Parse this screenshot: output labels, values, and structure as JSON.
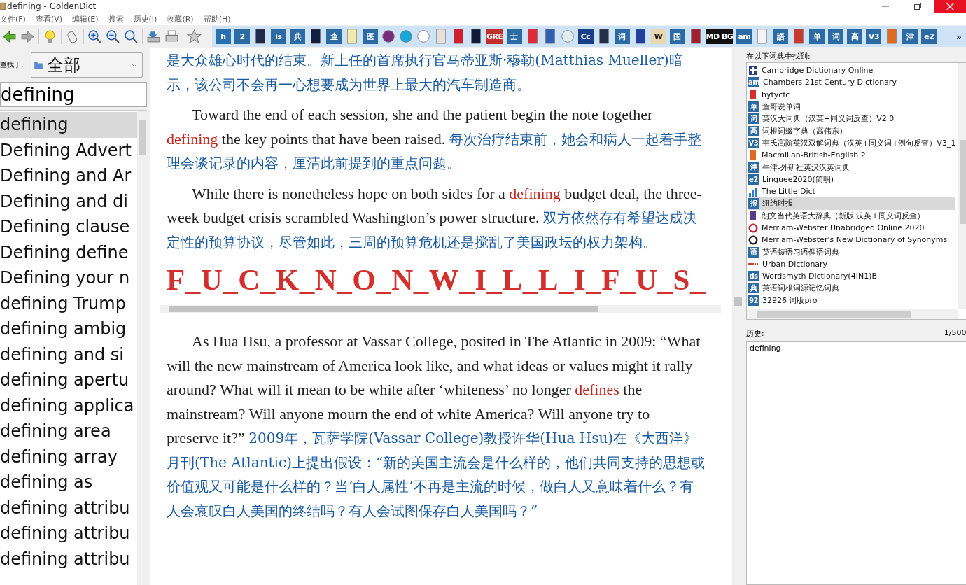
{
  "window": {
    "title": "defining - GoldenDict"
  },
  "menu": [
    "文件(F)",
    "查看(V)",
    "编辑(E)",
    "搜索",
    "历史(I)",
    "收藏(R)",
    "帮助(H)"
  ],
  "toolbar": [
    {
      "kind": "back"
    },
    {
      "kind": "forward"
    },
    {
      "kind": "sep"
    },
    {
      "kind": "bulb"
    },
    {
      "kind": "sep"
    },
    {
      "kind": "mouse"
    },
    {
      "kind": "sep"
    },
    {
      "kind": "zoomin"
    },
    {
      "kind": "zoomout"
    },
    {
      "kind": "zoomreset"
    },
    {
      "kind": "sep"
    },
    {
      "kind": "save"
    },
    {
      "kind": "print"
    },
    {
      "kind": "sep"
    },
    {
      "kind": "star"
    }
  ],
  "dict_bar": [
    {
      "kind": "tile",
      "label": "h",
      "color": "#2a6fb0"
    },
    {
      "kind": "tile",
      "label": "2",
      "color": "#2b6aa3"
    },
    {
      "kind": "book",
      "color": "#1d2a4a"
    },
    {
      "kind": "tile",
      "label": "is",
      "color": "#2b6aa3"
    },
    {
      "kind": "tile",
      "label": "典",
      "color": "#2b6aa3"
    },
    {
      "kind": "book",
      "color": "#142040"
    },
    {
      "kind": "tile",
      "label": "查",
      "color": "#2b6aa3"
    },
    {
      "kind": "book",
      "color": "#f3e9a8"
    },
    {
      "kind": "tile",
      "label": "医",
      "color": "#2b6aa3"
    },
    {
      "kind": "disc",
      "color": "#7a2d7a"
    },
    {
      "kind": "disc",
      "color": "#19a6d8"
    },
    {
      "kind": "disc",
      "color": "#ffffff"
    },
    {
      "kind": "book",
      "color": "#e8e0d8"
    },
    {
      "kind": "book",
      "color": "#d02030"
    },
    {
      "kind": "book",
      "color": "#101a38"
    },
    {
      "kind": "tile",
      "label": "GRE",
      "color": "#c0302a"
    },
    {
      "kind": "tile",
      "label": "士",
      "color": "#2b6aa3"
    },
    {
      "kind": "book",
      "color": "#e02a3a"
    },
    {
      "kind": "book",
      "color": "#3060b0"
    },
    {
      "kind": "disc",
      "color": "#e0eef0"
    },
    {
      "kind": "tile",
      "label": "Cc",
      "color": "#1a3f8a"
    },
    {
      "kind": "book",
      "color": "#24304a"
    },
    {
      "kind": "tile",
      "label": "词",
      "color": "#2b6aa3"
    },
    {
      "kind": "book",
      "color": "#2040a0"
    },
    {
      "kind": "tile",
      "label": "W",
      "color": "#e8d8b0"
    },
    {
      "kind": "tile",
      "label": "国",
      "color": "#2b6aa3"
    },
    {
      "kind": "book",
      "color": "#a02030"
    },
    {
      "kind": "tile",
      "label": "MD BG",
      "color": "#111111"
    },
    {
      "kind": "tile",
      "label": "am",
      "color": "#2b6aa3"
    },
    {
      "kind": "book",
      "color": "#f4f4f4"
    },
    {
      "kind": "tile",
      "label": "語",
      "color": "#2b6aa3"
    },
    {
      "kind": "book",
      "color": "#c83a30"
    },
    {
      "kind": "tile",
      "label": "单",
      "color": "#2b6aa3"
    },
    {
      "kind": "tile",
      "label": "词",
      "color": "#2b6aa3"
    },
    {
      "kind": "tile",
      "label": "高",
      "color": "#2b6aa3"
    },
    {
      "kind": "tile",
      "label": "V3",
      "color": "#2b6aa3"
    },
    {
      "kind": "book",
      "color": "#e06a20"
    },
    {
      "kind": "tile",
      "label": "津",
      "color": "#2b6aa3"
    },
    {
      "kind": "tile",
      "label": "e2",
      "color": "#2b6aa3"
    }
  ],
  "dict_bar_more": "»",
  "search": {
    "label": "查找于:",
    "group": "全部",
    "value": "defining"
  },
  "word_list": [
    {
      "text": "defining",
      "selected": true
    },
    {
      "text": "Defining Advert",
      "selected": false
    },
    {
      "text": "Defining and Ar",
      "selected": false
    },
    {
      "text": "Defining and di",
      "selected": false
    },
    {
      "text": "Defining clause",
      "selected": false
    },
    {
      "text": "Defining define",
      "selected": false
    },
    {
      "text": "Defining your n",
      "selected": false
    },
    {
      "text": "defining Trump",
      "selected": false
    },
    {
      "text": "defining ambig",
      "selected": false
    },
    {
      "text": "defining and si",
      "selected": false
    },
    {
      "text": "defining apertu",
      "selected": false
    },
    {
      "text": "defining applica",
      "selected": false
    },
    {
      "text": "defining area",
      "selected": false
    },
    {
      "text": "defining array",
      "selected": false
    },
    {
      "text": "defining as",
      "selected": false
    },
    {
      "text": "defining attribu",
      "selected": false
    },
    {
      "text": "defining attribu",
      "selected": false
    },
    {
      "text": "defining attribu",
      "selected": false
    }
  ],
  "article_top": {
    "paragraphs": [
      {
        "indent": false,
        "parts": [
          {
            "kind": "zh",
            "text": "是大众雄心时代的结束。新上任的首席执行官马蒂亚斯·穆勒(Matthias Mueller)暗示，该公司不会再一心想要成为世界上最大的汽车制造商。"
          }
        ]
      },
      {
        "indent": true,
        "parts": [
          {
            "kind": "en",
            "text": "Toward the end of each session, she and the patient begin the note together "
          },
          {
            "kind": "hl",
            "text": "defining"
          },
          {
            "kind": "en",
            "text": " the key points that have been raised. "
          },
          {
            "kind": "zh",
            "text": "每次治疗结束前，她会和病人一起着手整理会谈记录的内容，厘清此前提到的重点问题。"
          }
        ]
      },
      {
        "indent": true,
        "parts": [
          {
            "kind": "en",
            "text": "While there is nonetheless hope on both sides for a "
          },
          {
            "kind": "hl",
            "text": "defining"
          },
          {
            "kind": "en",
            "text": " budget deal, the three-week budget crisis scrambled Washington’s power structure. "
          },
          {
            "kind": "zh",
            "text": "双方依然存有希望达成决定性的预算协议，尽管如此，三周的预算危机还是搅乱了美国政坛的权力架构。"
          }
        ]
      }
    ],
    "banner": "F_U_C_K_N_O_N_W_I_L_L_I_F_U_S_"
  },
  "article_bottom": {
    "paragraphs": [
      {
        "indent": true,
        "parts": [
          {
            "kind": "en",
            "text": "As Hua Hsu, a professor at Vassar College, posited in The Atlantic in 2009: “What will the new mainstream of America look like, and what ideas or values might it rally around? What will it mean to be white after ‘whiteness’ no longer "
          },
          {
            "kind": "hl",
            "text": "defines"
          },
          {
            "kind": "en",
            "text": " the mainstream? Will anyone mourn the end of white America? Will anyone try to preserve it?” "
          },
          {
            "kind": "zh",
            "text": "2009年，瓦萨学院(Vassar College)教授许华(Hua Hsu)在《大西洋》月刊(The Atlantic)上提出假设：“新的美国主流会是什么样的，他们共同支持的思想或价值观又可能是什么样的？当‘白人属性’不再是主流的时候，做白人又意味着什么？有人会哀叹白人美国的终结吗？有人会试图保存白人美国吗？”"
          }
        ]
      }
    ]
  },
  "found_in": {
    "label": "在以下词典中找到:",
    "dictionaries": [
      {
        "name": "Cambridge Dictionary Online",
        "kind": "shield",
        "color": "#2a3f80",
        "selected": false
      },
      {
        "name": "Chambers 21st Century Dictionary",
        "kind": "tile",
        "badge": "am",
        "color": "#2b6aa3",
        "selected": false
      },
      {
        "name": "hytycfc",
        "kind": "book",
        "color": "#d03028",
        "selected": false
      },
      {
        "name": "童哥说单词",
        "kind": "tile",
        "badge": "单",
        "color": "#2b6aa3",
        "selected": false
      },
      {
        "name": "英汉大词典（汉英+同义词反查）V2.0",
        "kind": "tile",
        "badge": "词",
        "color": "#2b6aa3",
        "selected": false
      },
      {
        "name": "词根词缀字典（高伟东）",
        "kind": "tile",
        "badge": "高",
        "color": "#2b6aa3",
        "selected": false
      },
      {
        "name": "韦氏高阶英汉双解词典（汉英+同义词+例句反查）V3_1",
        "kind": "tile",
        "badge": "V3",
        "color": "#2b6aa3",
        "selected": false
      },
      {
        "name": "Macmillan-British-English 2",
        "kind": "book",
        "color": "#e06a20",
        "selected": false
      },
      {
        "name": "牛津-外研社英汉汉英词典",
        "kind": "tile",
        "badge": "津",
        "color": "#2b6aa3",
        "selected": false
      },
      {
        "name": "Linguee2020(简明)",
        "kind": "tile",
        "badge": "e2",
        "color": "#2b6aa3",
        "selected": false
      },
      {
        "name": "The Little Dict",
        "kind": "bars",
        "color": "#2d7ad0",
        "selected": false
      },
      {
        "name": "纽约时报",
        "kind": "tile",
        "badge": "报",
        "color": "#2b6aa3",
        "selected": true
      },
      {
        "name": "朗文当代英语大辞典（新版 汉英+同义词反查）",
        "kind": "book",
        "color": "#5a3a8a",
        "selected": false
      },
      {
        "name": "Merriam-Webster Unabridged Online 2020",
        "kind": "disc",
        "color": "#c02030",
        "selected": false
      },
      {
        "name": "Merriam-Webster's New Dictionary of Synonyms",
        "kind": "disc",
        "color": "#202020",
        "selected": false
      },
      {
        "name": "英语短语习语俚语词典",
        "kind": "tile",
        "badge": "语",
        "color": "#2b6aa3",
        "selected": false
      },
      {
        "name": "Urban Dictionary",
        "kind": "line",
        "color": "#d04030",
        "selected": false
      },
      {
        "name": "Wordsmyth Dictionary(4IN1)B",
        "kind": "tile",
        "badge": "ds",
        "color": "#2b6aa3",
        "selected": false
      },
      {
        "name": "英语词根词源记忆词典",
        "kind": "tile",
        "badge": "典",
        "color": "#2b6aa3",
        "selected": false
      },
      {
        "name": "32926 词版pro",
        "kind": "tile",
        "badge": "92",
        "color": "#2b6aa3",
        "selected": false
      }
    ]
  },
  "history": {
    "label": "历史:",
    "count": "1/500",
    "items": [
      "defining"
    ]
  }
}
